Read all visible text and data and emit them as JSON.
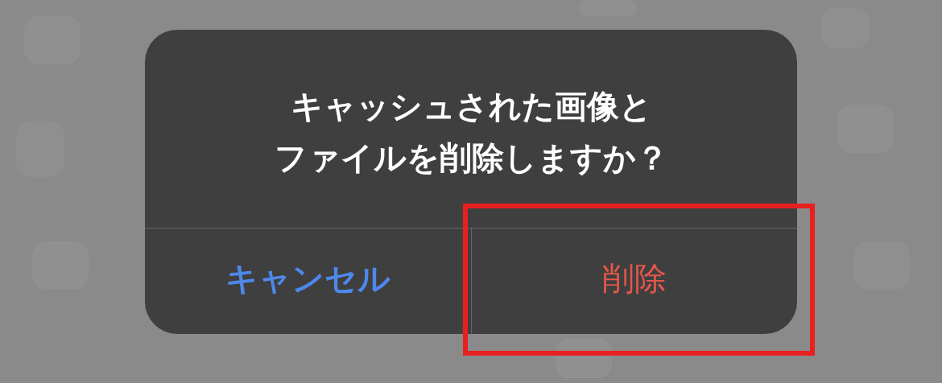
{
  "dialog": {
    "message_lines": [
      "キャッシュされた画像と",
      "ファイルを削除しますか？"
    ],
    "buttons": [
      {
        "label": "キャンセル",
        "kind": "cancel",
        "highlighted": false
      },
      {
        "label": "削除",
        "kind": "destructive",
        "highlighted": true
      }
    ]
  }
}
